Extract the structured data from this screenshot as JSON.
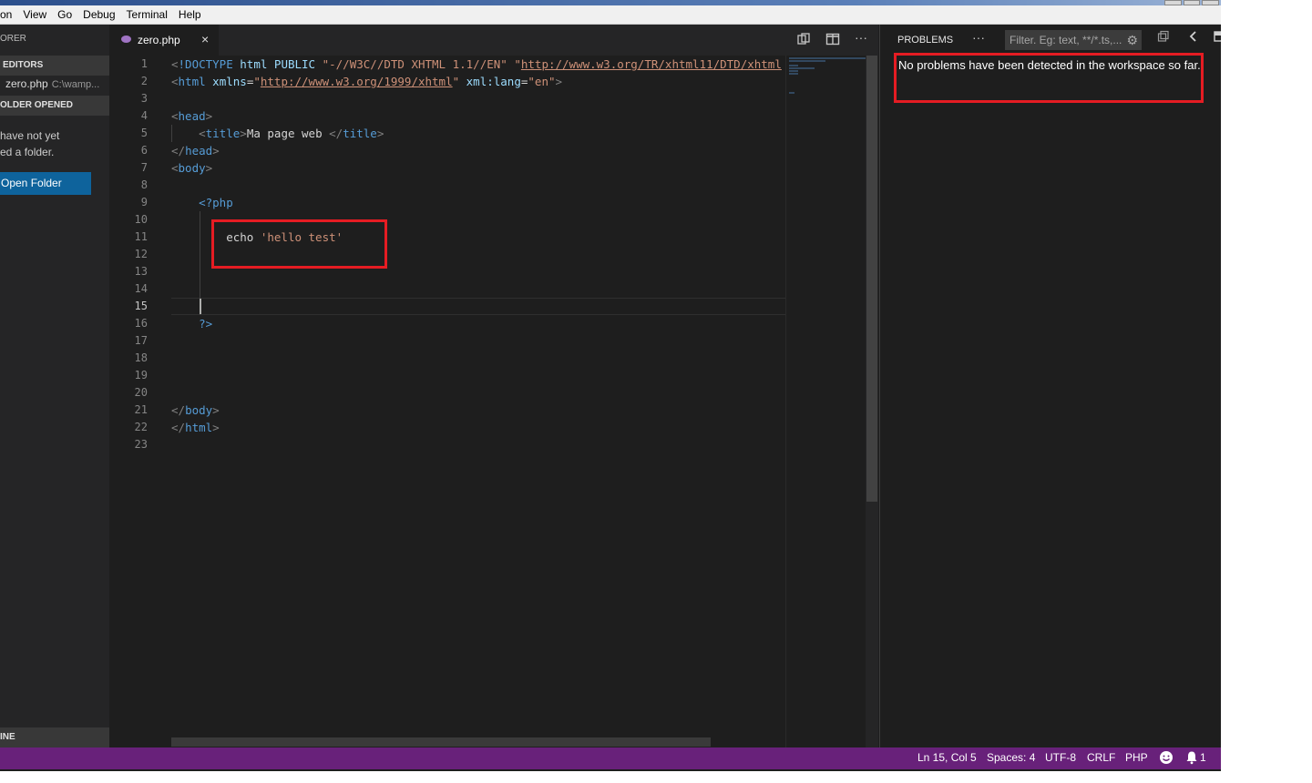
{
  "menu": {
    "items": [
      "on",
      "View",
      "Go",
      "Debug",
      "Terminal",
      "Help"
    ]
  },
  "sidebar": {
    "title": "ORER",
    "open_editors_header": "EDITORS",
    "open_file_name": "zero.php",
    "open_file_path": "C:\\wamp...",
    "no_folder_header": "OLDER OPENED",
    "message_line1": "have not yet",
    "message_line2": "ed a folder.",
    "open_folder_label": "Open Folder",
    "outline_header": "INE"
  },
  "tab": {
    "label": "zero.php",
    "close_glyph": "×"
  },
  "editor": {
    "active_line": 15,
    "line_numbers": [
      "1",
      "2",
      "3",
      "4",
      "5",
      "6",
      "7",
      "8",
      "9",
      "10",
      "11",
      "12",
      "13",
      "14",
      "15",
      "16",
      "17",
      "18",
      "19",
      "20",
      "21",
      "22",
      "23"
    ]
  },
  "panel": {
    "title": "PROBLEMS",
    "more_glyph": "···",
    "filter_placeholder": "Filter. Eg: text, **/*.ts,...",
    "message": "No problems have been detected in the workspace so far."
  },
  "status": {
    "position": "Ln 15, Col 5",
    "spaces": "Spaces: 4",
    "encoding": "UTF-8",
    "eol": "CRLF",
    "language": "PHP",
    "notifications": "1"
  },
  "colors": {
    "accent": "#68217a",
    "button": "#0e639c",
    "highlight": "#e51c23"
  },
  "icons": [
    "php-file-icon",
    "close-icon",
    "open-changes-icon",
    "split-editor-icon",
    "more-actions-icon",
    "filter-settings-icon",
    "collapse-icon",
    "chevron-left-icon",
    "maximize-panel-icon",
    "feedback-smiley-icon",
    "bell-icon"
  ]
}
